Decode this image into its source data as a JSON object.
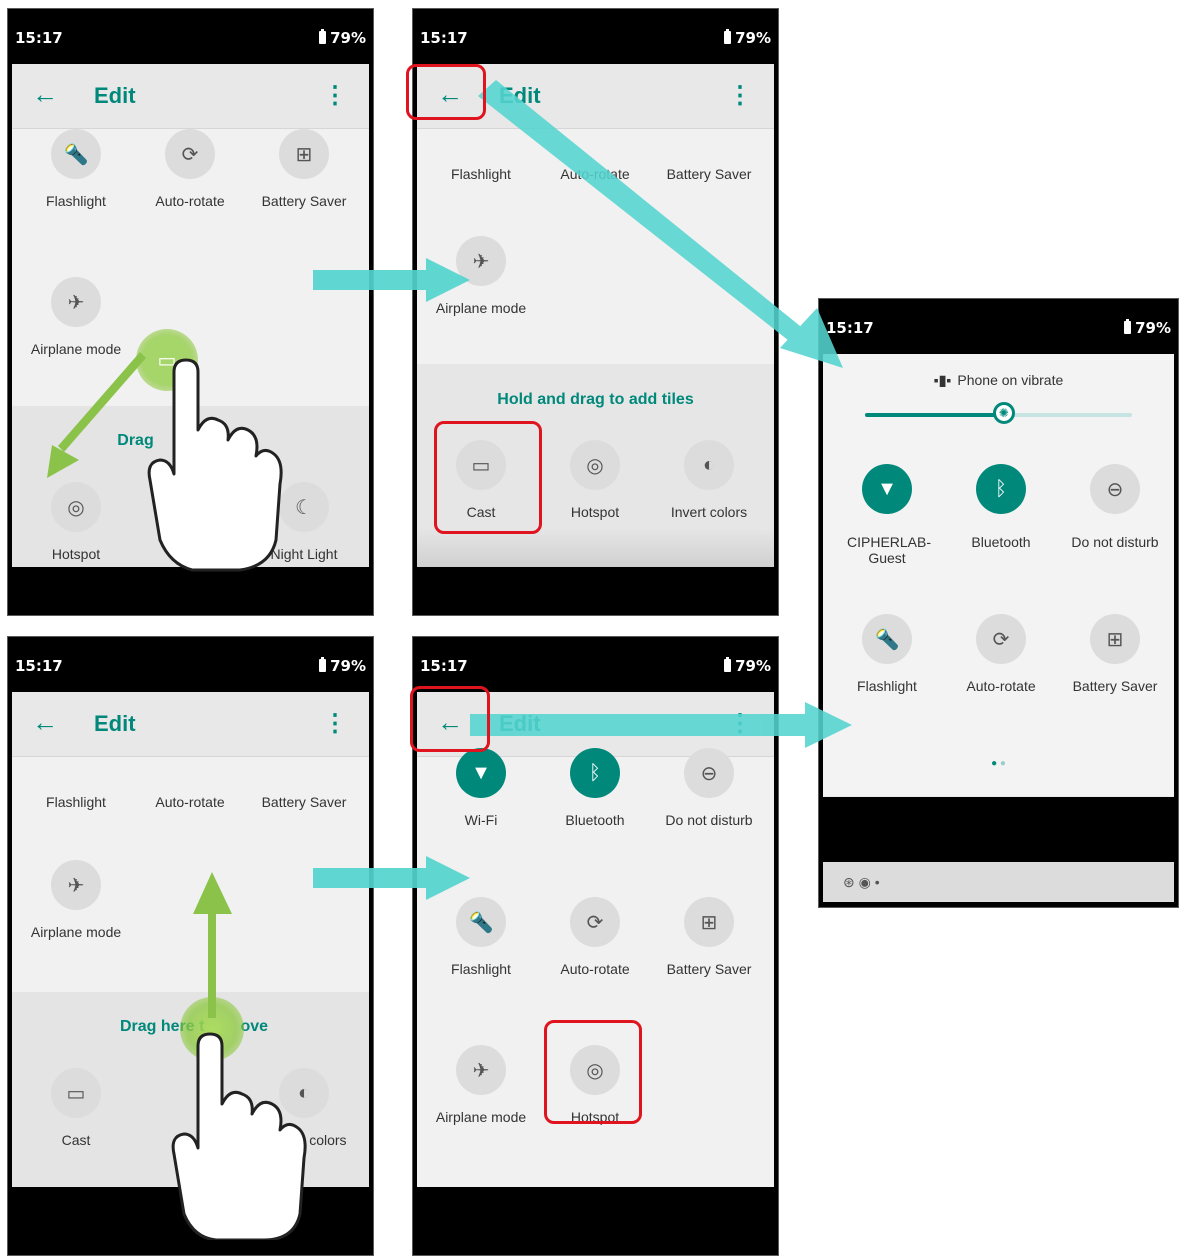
{
  "status": {
    "time": "15:17",
    "battery": "79%"
  },
  "toolbar": {
    "title": "Edit",
    "back_icon": "←",
    "menu_icon": "⋮"
  },
  "tiles": {
    "flashlight": "Flashlight",
    "autorotate": "Auto-rotate",
    "battery_saver": "Battery Saver",
    "airplane": "Airplane mode",
    "cast": "Cast",
    "hotspot": "Hotspot",
    "invert": "Invert colors",
    "night": "Night Light",
    "wifi": "Wi-Fi",
    "bluetooth": "Bluetooth",
    "dnd": "Do not disturb"
  },
  "fragments": {
    "drag_partial": "Drag",
    "invert_partial": "Inver",
    "invert_tail": "t colors",
    "remove_a": "Drag here t",
    "remove_b": "ove"
  },
  "hints": {
    "add_tiles": "Hold and drag to add tiles"
  },
  "quick_settings": {
    "status": "Phone on vibrate",
    "wifi_name": "CIPHERLAB-Guest",
    "brightness_level": 0.52
  },
  "colors": {
    "accent": "#00897b",
    "arrow": "#54d4cf",
    "highlight": "#e0141f",
    "gesture": "#8bc34a"
  }
}
